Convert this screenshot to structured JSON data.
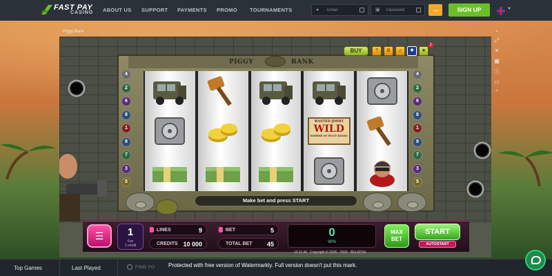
{
  "header": {
    "logo_top": "FAST PAY",
    "logo_bottom": "CASINO",
    "nav": [
      "ABOUT US",
      "SUPPORT",
      "PAYMENTS",
      "PROMO",
      "TOURNAMENTS"
    ],
    "email_placeholder": "Email",
    "password_placeholder": "Password",
    "submit_icon": "arrow-right-icon",
    "signup_label": "SIGN UP",
    "language_icon": "uk-flag-icon"
  },
  "game": {
    "window_title": "Piggy Bank",
    "title_left": "PIGGY",
    "title_right": "BANK",
    "buy_label": "BUY",
    "notif_count": "1",
    "lines_left": [
      "4",
      "2",
      "6",
      "8",
      "1",
      "9",
      "7",
      "3",
      "5"
    ],
    "lines_right": [
      "4",
      "2",
      "6",
      "8",
      "1",
      "9",
      "7",
      "3",
      "5"
    ],
    "reels": [
      [
        "truck",
        "safe",
        "cash"
      ],
      [
        "hammer",
        "coins",
        "cash"
      ],
      [
        "truck",
        "coins",
        "cash"
      ],
      [
        "truck",
        "wild",
        "safe"
      ],
      [
        "safe",
        "hammer",
        "robber"
      ]
    ],
    "wild_text_top": "WANTED JIMMY",
    "wild_text_mid": "WILD",
    "wild_text_bot": "ROBBER OF PIGGY BANKS",
    "message": "Make bet and press START"
  },
  "panel": {
    "menu_icon": "hamburger-menu-icon",
    "bet_level_value": "1",
    "bet_level_label_1": "Fun",
    "bet_level_label_2": "1 credit",
    "lines_label": "LINES",
    "lines_value": "9",
    "bet_label": "BET",
    "bet_value": "5",
    "credits_label": "CREDITS",
    "credits_value": "10 000",
    "total_bet_label": "TOTAL BET",
    "total_bet_value": "45",
    "win_value": "0",
    "win_label": "WIN",
    "max_bet_label_1": "MAX",
    "max_bet_label_2": "BET",
    "start_label": "START",
    "autostart_label": "AUTOSTART",
    "footer_time": "15:11:40",
    "footer_copyright": "Copyright © 2005 - 2020",
    "footer_brand": "BELATRA"
  },
  "side_rail": [
    "chevron-down-icon",
    "expand-icon",
    "close-icon",
    "rules-icon",
    "info-icon",
    "monitor-icon",
    "chevron-up-icon"
  ],
  "bottom": {
    "tab_top_games": "Top Games",
    "tab_last_played": "Last Played",
    "find_placeholder": "FIND YO",
    "watermark": "Protected with free version of Watermarkly. Full version doesn't put this mark.",
    "chat_icon": "chat-bubble-icon"
  },
  "colors": {
    "signup_green": "#6cbf2a",
    "submit_orange": "#f0a92a",
    "panel_pink": "#ff4fa6",
    "win_green": "#5fe0a8"
  }
}
